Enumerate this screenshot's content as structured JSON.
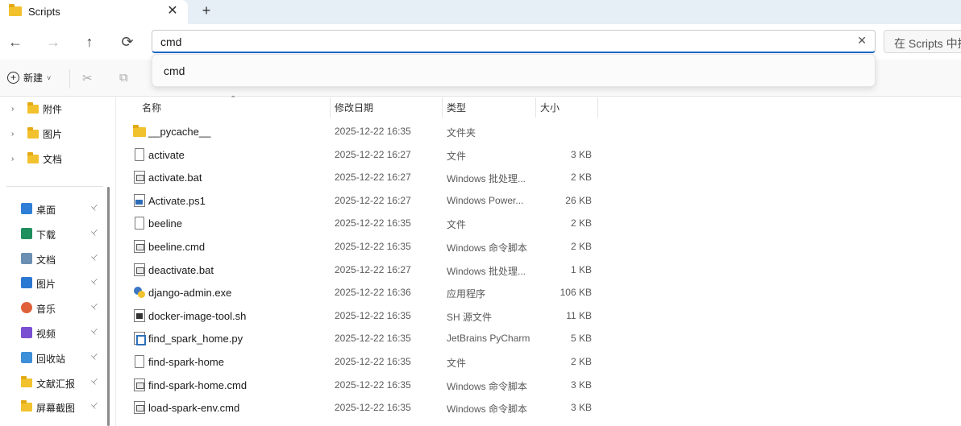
{
  "tab": {
    "title": "Scripts",
    "close": "✕",
    "new": "+"
  },
  "nav": {
    "back": "←",
    "forward": "→",
    "up": "↑",
    "refresh": "⟳",
    "address_value": "cmd",
    "clear": "✕",
    "search_placeholder": "在 Scripts 中搜"
  },
  "toolbar": {
    "new_label": "新建",
    "new_chevron": "˅",
    "cut": "✂",
    "copy": "⧉"
  },
  "dropdown": {
    "suggestion": "cmd"
  },
  "sidebar": {
    "tree": [
      {
        "label": "附件",
        "arrow": "›"
      },
      {
        "label": "图片",
        "arrow": "›"
      },
      {
        "label": "文档",
        "arrow": "›"
      }
    ],
    "quick_access": [
      {
        "label": "桌面",
        "icon": "desktop-icon",
        "color": "#2f7fd6"
      },
      {
        "label": "下载",
        "icon": "download-icon",
        "color": "#1f8f5e"
      },
      {
        "label": "文档",
        "icon": "documents-icon",
        "color": "#6b8fb3"
      },
      {
        "label": "图片",
        "icon": "pictures-icon",
        "color": "#2a78d1"
      },
      {
        "label": "音乐",
        "icon": "music-icon",
        "color": "#e0603a"
      },
      {
        "label": "视频",
        "icon": "videos-icon",
        "color": "#7a4fd1"
      },
      {
        "label": "回收站",
        "icon": "recycle-bin-icon",
        "color": "#3d8fd8"
      },
      {
        "label": "文献汇报",
        "icon": "folder-icon",
        "color": "#f2c12e"
      },
      {
        "label": "屏幕截图",
        "icon": "folder-icon",
        "color": "#f2c12e"
      }
    ],
    "pin": "📌"
  },
  "columns": {
    "name": "名称",
    "date": "修改日期",
    "type": "类型",
    "size": "大小",
    "sort_indicator": "⌃"
  },
  "files": [
    {
      "name": "__pycache__",
      "date": "2025-12-22 16:35",
      "type": "文件夹",
      "size": "",
      "icon": "folder"
    },
    {
      "name": "activate",
      "date": "2025-12-22 16:27",
      "type": "文件",
      "size": "3 KB",
      "icon": "doc"
    },
    {
      "name": "activate.bat",
      "date": "2025-12-22 16:27",
      "type": "Windows 批处理...",
      "size": "2 KB",
      "icon": "bat"
    },
    {
      "name": "Activate.ps1",
      "date": "2025-12-22 16:27",
      "type": "Windows Power...",
      "size": "26 KB",
      "icon": "ps"
    },
    {
      "name": "beeline",
      "date": "2025-12-22 16:35",
      "type": "文件",
      "size": "2 KB",
      "icon": "doc"
    },
    {
      "name": "beeline.cmd",
      "date": "2025-12-22 16:35",
      "type": "Windows 命令脚本",
      "size": "2 KB",
      "icon": "bat"
    },
    {
      "name": "deactivate.bat",
      "date": "2025-12-22 16:27",
      "type": "Windows 批处理...",
      "size": "1 KB",
      "icon": "bat"
    },
    {
      "name": "django-admin.exe",
      "date": "2025-12-22 16:36",
      "type": "应用程序",
      "size": "106 KB",
      "icon": "exe"
    },
    {
      "name": "docker-image-tool.sh",
      "date": "2025-12-22 16:35",
      "type": "SH 源文件",
      "size": "11 KB",
      "icon": "sh"
    },
    {
      "name": "find_spark_home.py",
      "date": "2025-12-22 16:35",
      "type": "JetBrains PyCharm",
      "size": "5 KB",
      "icon": "py"
    },
    {
      "name": "find-spark-home",
      "date": "2025-12-22 16:35",
      "type": "文件",
      "size": "2 KB",
      "icon": "doc"
    },
    {
      "name": "find-spark-home.cmd",
      "date": "2025-12-22 16:35",
      "type": "Windows 命令脚本",
      "size": "3 KB",
      "icon": "bat"
    },
    {
      "name": "load-spark-env.cmd",
      "date": "2025-12-22 16:35",
      "type": "Windows 命令脚本",
      "size": "3 KB",
      "icon": "bat"
    }
  ]
}
